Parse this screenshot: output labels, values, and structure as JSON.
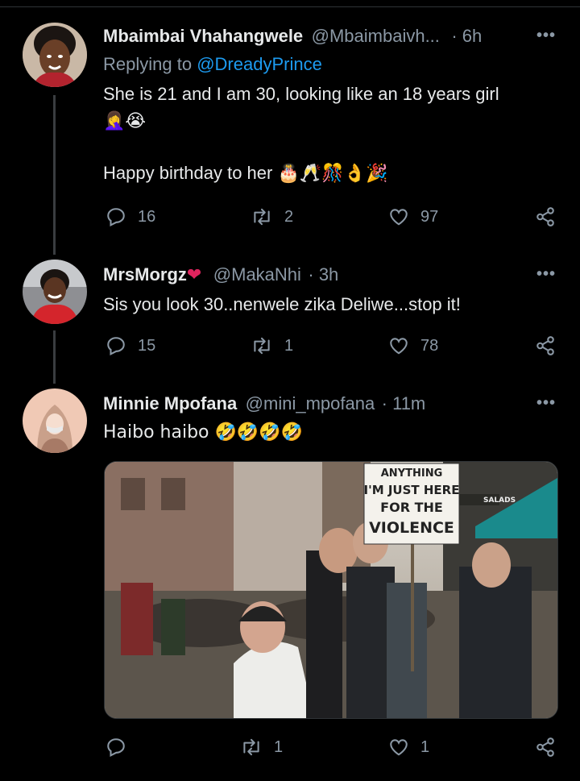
{
  "tweets": [
    {
      "name": "Mbaimbai Vhahangwele",
      "handle": "@Mbaimbaivh...",
      "time": "· 6h",
      "replying_prefix": "Replying to ",
      "replying_to": "@DreadyPrince",
      "line1": "She is 21 and I am 30, looking like an 18 years girl",
      "line2": "🤦‍♀️😭",
      "line3": "Happy birthday to her 🎂🥂🎊👌🎉",
      "replies": "16",
      "retweets": "2",
      "likes": "97"
    },
    {
      "name": "MrsMorgz",
      "name_suffix": "❤",
      "handle": "@MakaNhi",
      "time": "· 3h",
      "line1": "Sis you look 30..nenwele zika Deliwe...stop it!",
      "replies": "15",
      "retweets": "1",
      "likes": "78"
    },
    {
      "name": "Minnie Mpofana",
      "handle": "@mini_mpofana",
      "time": "· 11m",
      "line1": "Haibo haibo 🤣🤣🤣🤣",
      "replies": "",
      "retweets": "1",
      "likes": "1",
      "media_sign": [
        "ANYTHING",
        "I'M JUST HERE",
        "FOR THE",
        "VIOLENCE"
      ],
      "media_shop_sign": "SALADS"
    }
  ],
  "more_label": "•••",
  "colors": {
    "accent": "#1d9bf0",
    "muted": "#8b98a5",
    "heart": "#e0245e"
  },
  "icons": [
    "reply-icon",
    "retweet-icon",
    "like-icon",
    "share-icon",
    "more-icon"
  ]
}
